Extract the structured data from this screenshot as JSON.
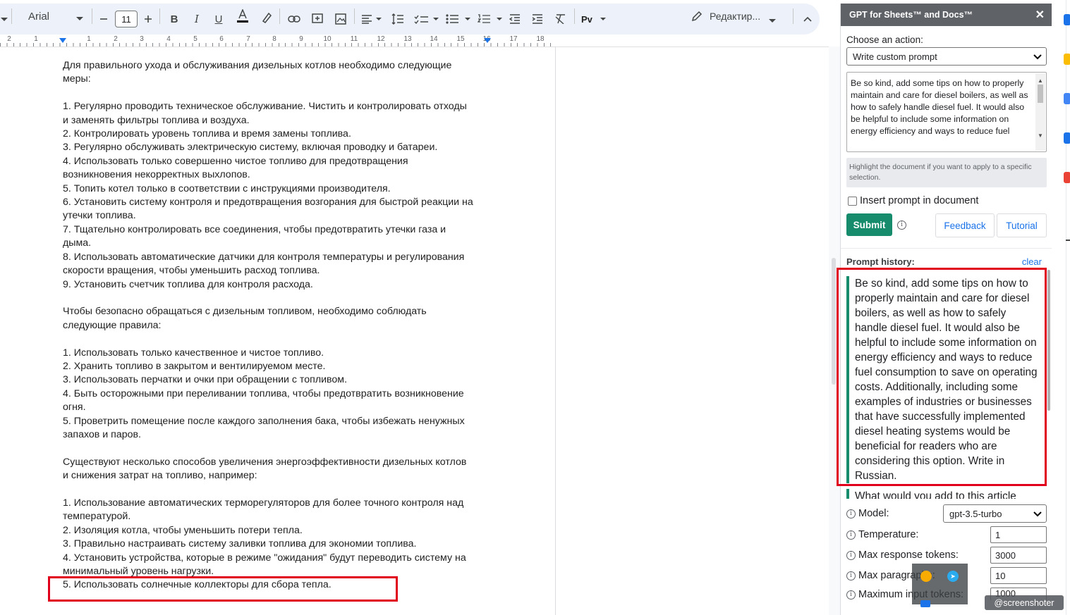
{
  "toolbar": {
    "font_name": "Arial",
    "font_size": "11",
    "mode_label": "Редактир..."
  },
  "ruler": {
    "numbers": [
      "2",
      "1",
      "1",
      "2",
      "3",
      "4",
      "5",
      "6",
      "7",
      "8",
      "9",
      "10",
      "11",
      "12",
      "13",
      "14",
      "15",
      "16",
      "17",
      "18"
    ]
  },
  "document": {
    "body": "Для правильного ухода и обслуживания дизельных котлов необходимо следующие\nмеры:\n\n1. Регулярно проводить техническое обслуживание. Чистить и контролировать отходы\nи заменять фильтры топлива и воздуха.\n2. Контролировать уровень топлива и время замены топлива.\n3. Регулярно обслуживать электрическую систему, включая проводку и батареи.\n4. Использовать только совершенно чистое топливо для предотвращения\nвозникновения некорректных выхлопов.\n5. Топить котел только в соответствии с инструкциями производителя.\n6. Установить систему контроля и предотвращения возгорания для быстрой реакции на\nутечки топлива.\n7. Тщательно контролировать все соединения, чтобы предотвратить утечки газа и\nдыма.\n8. Использовать автоматические датчики для контроля температуры и регулирования\nскорости вращения, чтобы уменьшить расход топлива.\n9. Установить счетчик топлива для контроля расхода.\n\nЧтобы безопасно обращаться с дизельным топливом, необходимо соблюдать\nследующие правила:\n\n1. Использовать только качественное и чистое топливо.\n2. Хранить топливо в закрытом и вентилируемом месте.\n3. Использовать перчатки и очки при обращении с топливом.\n4. Быть осторожными при переливании топлива, чтобы предотвратить возникновение\nогня.\n5. Проветрить помещение после каждого заполнения бака, чтобы избежать ненужных\nзапахов и паров.\n\nСуществуют несколько способов увеличения энергоэффективности дизельных котлов\nи снижения затрат на топливо, например:\n\n1. Использование автоматических терморегуляторов для более точного контроля над\nтемпературой.\n2. Изоляция котла, чтобы уменьшить потери тепла.\n3. Правильно настраивать систему заливки топлива для экономии топлива.\n4. Установить устройства, которые в режиме \"ожидания\" будут переводить систему на\nминимальный уровень нагрузки.\n5. Использовать солнечные коллекторы для сбора тепла."
  },
  "sidebar": {
    "title": "GPT for Sheets™ and Docs™",
    "close": "✕",
    "action_label": "Choose an action:",
    "action_value": "Write custom prompt",
    "prompt_text": "Be so kind, add some tips on how to properly maintain and care for diesel boilers, as well as how to safely handle diesel fuel. It would also be helpful to include some information on energy efficiency and ways to reduce fuel",
    "hint": "Highlight the document if you want to apply to a specific selection.",
    "insert_label": "Insert prompt in document",
    "submit": "Submit",
    "feedback": "Feedback",
    "tutorial": "Tutorial",
    "history_label": "Prompt history:",
    "clear": "clear",
    "history": [
      "Be so kind, add some tips on how to properly maintain and care for diesel boilers, as well as how to safely handle diesel fuel. It would also be helpful to include some information on energy efficiency and ways to reduce fuel consumption to save on operating costs. Additionally, including some examples of industries or businesses that have successfully implemented diesel heating systems would be beneficial for readers who are considering this option. Write in Russian.",
      "What would you add to this article"
    ],
    "model_label": "Model:",
    "model_value": "gpt-3.5-turbo",
    "temperature_label": "Temperature:",
    "temperature_value": "1",
    "max_tokens_label": "Max response tokens:",
    "max_tokens_value": "3000",
    "max_paragraphs_label": "Max paragraphs:",
    "max_paragraphs_value": "10",
    "max_input_label": "Maximum input tokens:",
    "max_input_value": "1000"
  },
  "watermark": "@screenshoter",
  "colors": {
    "accent": "#168c6d",
    "link": "#1a73e8",
    "highlight": "#e0001b",
    "toolbar_bg": "#edf2fa"
  }
}
